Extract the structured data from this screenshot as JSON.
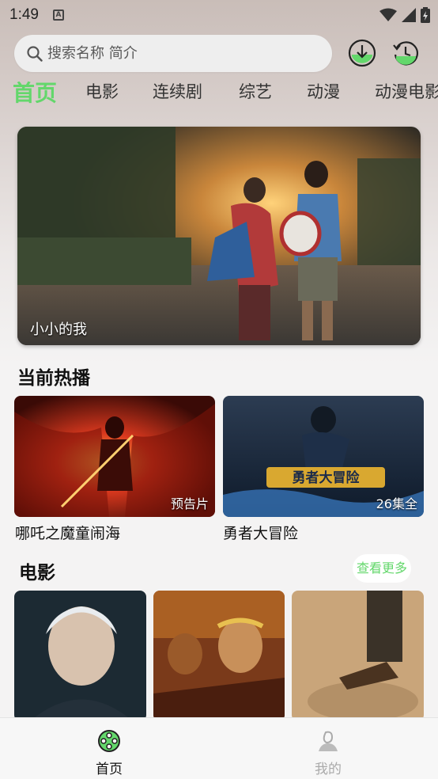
{
  "status_bar": {
    "time": "1:49",
    "notification_glyph": "A"
  },
  "search": {
    "placeholder": "搜索名称 简介"
  },
  "top_actions": [
    "download-icon",
    "history-icon"
  ],
  "tabs": [
    {
      "label": "首页",
      "active": true
    },
    {
      "label": "电影",
      "active": false
    },
    {
      "label": "连续剧",
      "active": false
    },
    {
      "label": "综艺",
      "active": false
    },
    {
      "label": "动漫",
      "active": false
    },
    {
      "label": "动漫电影",
      "active": false
    }
  ],
  "banner": {
    "title": "小小的我"
  },
  "now_playing": {
    "title": "当前热播",
    "items": [
      {
        "title": "哪吒之魔童闹海",
        "badge": "预告片"
      },
      {
        "title": "勇者大冒险",
        "badge": "26集全"
      }
    ]
  },
  "movies": {
    "title": "电影",
    "more_label": "查看更多",
    "count_visible": 3
  },
  "bottom_nav": [
    {
      "label": "首页",
      "active": true
    },
    {
      "label": "我的",
      "active": false
    }
  ],
  "colors": {
    "accent": "#63d76b",
    "inactive": "#aaaaaa"
  }
}
